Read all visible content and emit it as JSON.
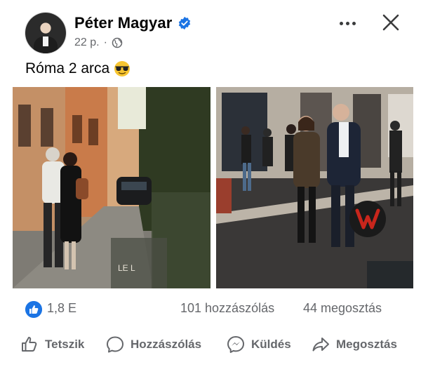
{
  "post": {
    "author": "Péter Magyar",
    "time": "22 p.",
    "separator": "·",
    "caption": "Róma 2 arca"
  },
  "photo_left": {
    "sign_text": "LE L"
  },
  "stats": {
    "reactions": "1,8 E",
    "comments": "101 hozzászólás",
    "shares": "44 megosztás"
  },
  "actions": {
    "like": "Tetszik",
    "comment": "Hozzászólás",
    "send": "Küldés",
    "share": "Megosztás"
  },
  "colors": {
    "accent": "#1b74e4",
    "secondary_text": "#65676b",
    "watermark": "#c8261c"
  },
  "icons": [
    "more-icon",
    "close-icon",
    "verified-badge-icon",
    "globe-icon",
    "sunglasses-emoji-icon",
    "like-reaction-icon",
    "thumbs-up-icon",
    "comment-icon",
    "messenger-icon",
    "share-icon"
  ]
}
